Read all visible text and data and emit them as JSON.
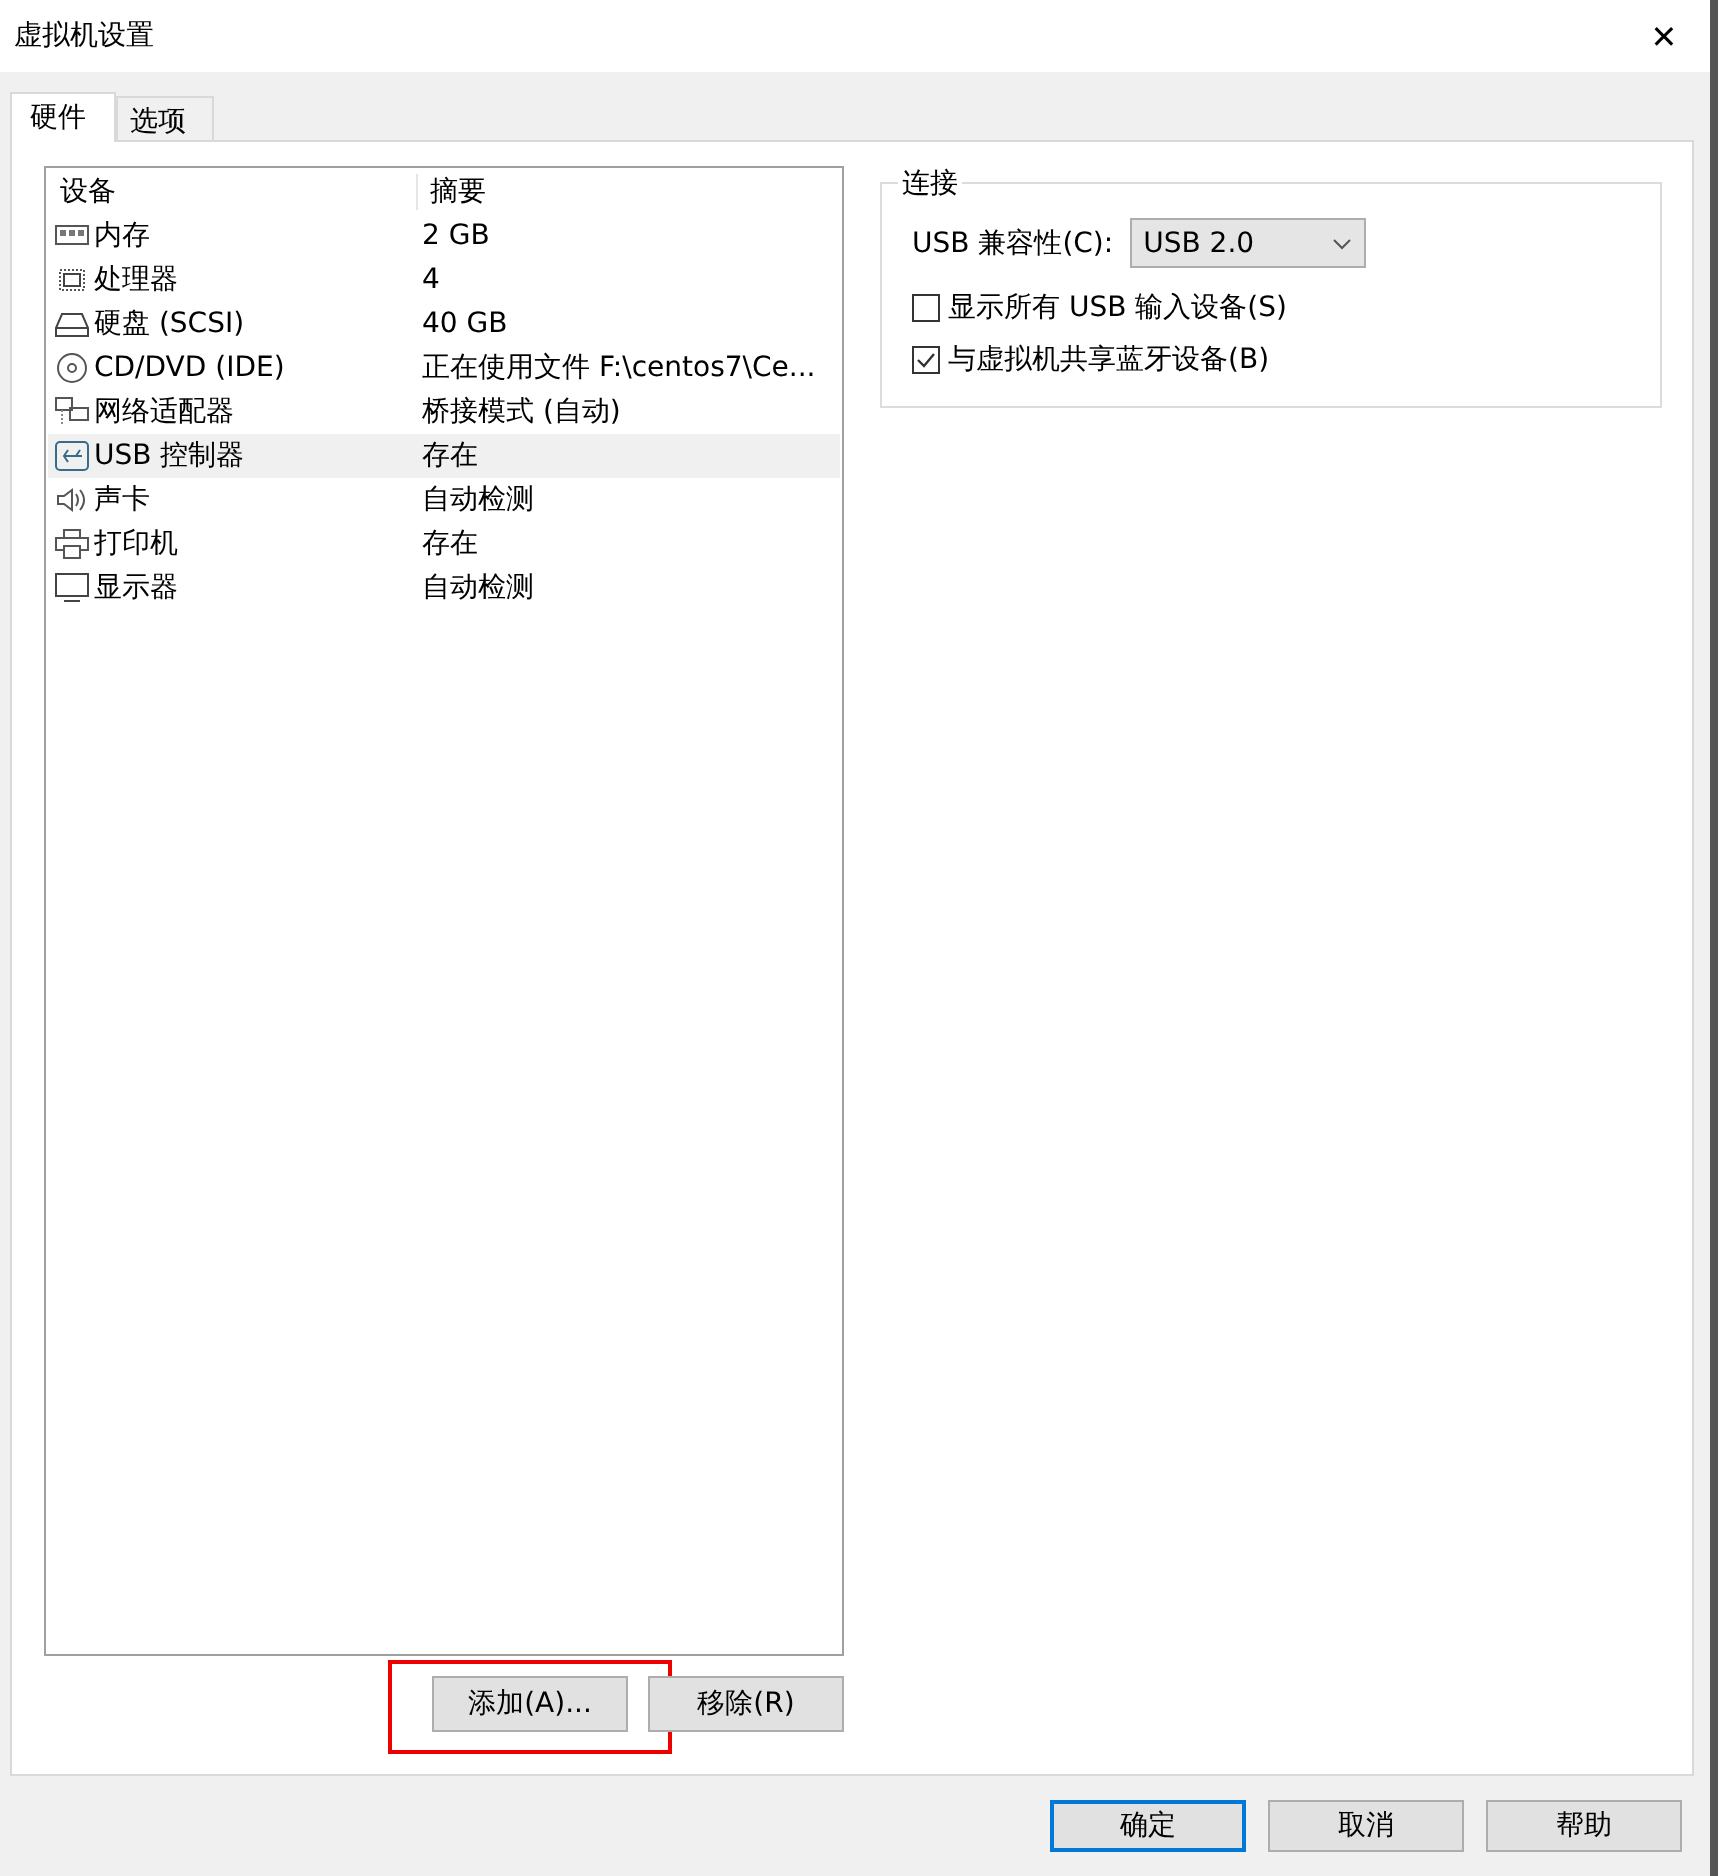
{
  "window": {
    "title": "虚拟机设置",
    "close": "✕"
  },
  "tabs": [
    {
      "label": "硬件",
      "selected": true
    },
    {
      "label": "选项",
      "selected": false
    }
  ],
  "device_list": {
    "columns": [
      "设备",
      "摘要"
    ],
    "rows": [
      {
        "device": "内存",
        "summary": "2 GB",
        "selected": false
      },
      {
        "device": "处理器",
        "summary": "4",
        "selected": false
      },
      {
        "device": "硬盘 (SCSI)",
        "summary": "40 GB",
        "selected": false
      },
      {
        "device": "CD/DVD (IDE)",
        "summary": "正在使用文件 F:\\centos7\\Ce...",
        "selected": false
      },
      {
        "device": "网络适配器",
        "summary": "桥接模式 (自动)",
        "selected": false
      },
      {
        "device": "USB 控制器",
        "summary": "存在",
        "selected": true
      },
      {
        "device": "声卡",
        "summary": "自动检测",
        "selected": false
      },
      {
        "device": "打印机",
        "summary": "存在",
        "selected": false
      },
      {
        "device": "显示器",
        "summary": "自动检测",
        "selected": false
      }
    ]
  },
  "connection": {
    "title": "连接",
    "compat_label": "USB 兼容性(C):",
    "compat_value": "USB 2.0",
    "checkboxes": [
      {
        "label": "显示所有 USB 输入设备(S)",
        "checked": false
      },
      {
        "label": "与虚拟机共享蓝牙设备(B)",
        "checked": true
      }
    ]
  },
  "list_buttons": [
    {
      "label": "添加(A)...",
      "highlighted": true
    },
    {
      "label": "移除(R)",
      "highlighted": false
    }
  ],
  "dialog_buttons": [
    {
      "label": "确定",
      "default": true
    },
    {
      "label": "取消",
      "default": false
    },
    {
      "label": "帮助",
      "default": false
    }
  ]
}
